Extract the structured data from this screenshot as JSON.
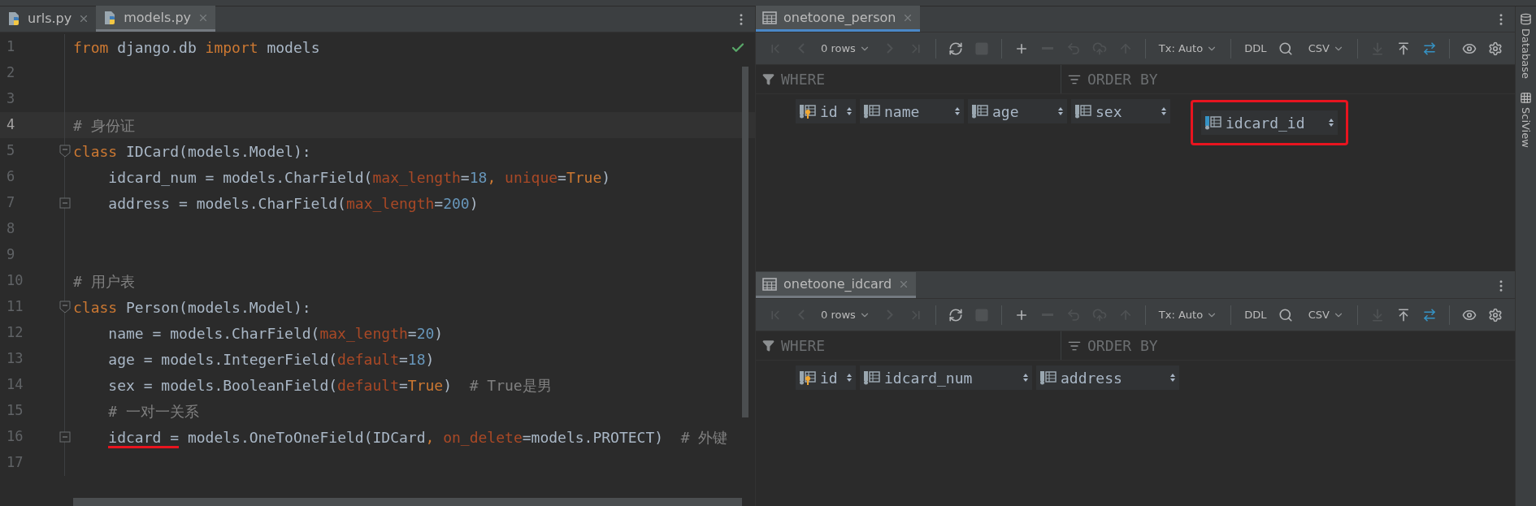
{
  "editor": {
    "focused": false,
    "inspections_ok": true,
    "tabs": [
      {
        "label": "urls.py",
        "selected": false
      },
      {
        "label": "models.py",
        "selected": true
      }
    ],
    "lines": [
      {
        "number": "1",
        "current": false,
        "kind": "plain",
        "tokens": [
          {
            "t": "from",
            "kind": "kw"
          },
          {
            "t": " django.db ",
            "kind": "text"
          },
          {
            "t": "import",
            "kind": "kw"
          },
          {
            "t": " models",
            "kind": "text"
          }
        ]
      },
      {
        "number": "2",
        "current": false,
        "kind": "plain"
      },
      {
        "number": "3",
        "current": false,
        "kind": "plain"
      },
      {
        "number": "4",
        "current": true,
        "kind": "plain",
        "tokens": [
          {
            "t": "# 身份证",
            "kind": "comment"
          }
        ]
      },
      {
        "number": "5",
        "current": false,
        "kind": "fold_start",
        "tokens": [
          {
            "t": "class",
            "kind": "kw"
          },
          {
            "t": " IDCard(models.Model):",
            "kind": "text"
          }
        ]
      },
      {
        "number": "6",
        "current": false,
        "kind": "plain",
        "tokens": [
          {
            "t": "    idcard_num = models.CharField(",
            "kind": "text"
          },
          {
            "t": "max_length",
            "kind": "param"
          },
          {
            "t": "=",
            "kind": "text"
          },
          {
            "t": "18",
            "kind": "num"
          },
          {
            "t": ", ",
            "kind": "kw"
          },
          {
            "t": "unique",
            "kind": "param"
          },
          {
            "t": "=",
            "kind": "text"
          },
          {
            "t": "True",
            "kind": "kw"
          },
          {
            "t": ")",
            "kind": "text"
          }
        ]
      },
      {
        "number": "7",
        "current": false,
        "kind": "fold_end",
        "tokens": [
          {
            "t": "    address = models.CharField(",
            "kind": "text"
          },
          {
            "t": "max_length",
            "kind": "param"
          },
          {
            "t": "=",
            "kind": "text"
          },
          {
            "t": "200",
            "kind": "num"
          },
          {
            "t": ")",
            "kind": "text"
          }
        ]
      },
      {
        "number": "8",
        "current": false,
        "kind": "plain"
      },
      {
        "number": "9",
        "current": false,
        "kind": "plain"
      },
      {
        "number": "10",
        "current": false,
        "kind": "plain",
        "tokens": [
          {
            "t": "# 用户表",
            "kind": "comment"
          }
        ]
      },
      {
        "number": "11",
        "current": false,
        "kind": "fold_start",
        "tokens": [
          {
            "t": "class",
            "kind": "kw"
          },
          {
            "t": " Person(models.Model):",
            "kind": "text"
          }
        ]
      },
      {
        "number": "12",
        "current": false,
        "kind": "plain",
        "tokens": [
          {
            "t": "    name = models.CharField(",
            "kind": "text"
          },
          {
            "t": "max_length",
            "kind": "param"
          },
          {
            "t": "=",
            "kind": "text"
          },
          {
            "t": "20",
            "kind": "num"
          },
          {
            "t": ")",
            "kind": "text"
          }
        ]
      },
      {
        "number": "13",
        "current": false,
        "kind": "plain",
        "tokens": [
          {
            "t": "    age = models.IntegerField(",
            "kind": "text"
          },
          {
            "t": "default",
            "kind": "param"
          },
          {
            "t": "=",
            "kind": "text"
          },
          {
            "t": "18",
            "kind": "num"
          },
          {
            "t": ")",
            "kind": "text"
          }
        ]
      },
      {
        "number": "14",
        "current": false,
        "kind": "plain",
        "tokens": [
          {
            "t": "    sex = models.BooleanField(",
            "kind": "text"
          },
          {
            "t": "default",
            "kind": "param"
          },
          {
            "t": "=",
            "kind": "text"
          },
          {
            "t": "True",
            "kind": "kw"
          },
          {
            "t": ")  ",
            "kind": "text"
          },
          {
            "t": "# True是男",
            "kind": "comment"
          }
        ]
      },
      {
        "number": "15",
        "current": false,
        "kind": "plain",
        "tokens": [
          {
            "t": "    # 一对一关系",
            "kind": "comment"
          }
        ]
      },
      {
        "number": "16",
        "current": false,
        "kind": "fold_end",
        "tokens": [
          {
            "t": "    idcard =",
            "kind": "text",
            "underlined": true
          },
          {
            "t": " models.OneToOneField(IDCard",
            "kind": "text"
          },
          {
            "t": ", ",
            "kind": "kw"
          },
          {
            "t": "on_delete",
            "kind": "param"
          },
          {
            "t": "=models.PROTECT)  ",
            "kind": "text"
          },
          {
            "t": "# 外键",
            "kind": "comment"
          }
        ]
      },
      {
        "number": "17",
        "current": false,
        "kind": "plain"
      }
    ]
  },
  "panels": [
    {
      "focused": true,
      "tab": {
        "label": "onetoone_person",
        "selected": true
      },
      "toolbar_left": [
        {
          "kind": "first",
          "disabled": true
        },
        {
          "kind": "prev",
          "disabled": true
        },
        {
          "kind": "dropdown",
          "label": "0 rows",
          "disabled": false
        },
        {
          "kind": "next",
          "disabled": true
        },
        {
          "kind": "last",
          "disabled": true
        },
        {
          "kind": "separator"
        },
        {
          "kind": "refresh",
          "disabled": false
        },
        {
          "kind": "stop",
          "disabled": true
        },
        {
          "kind": "separator"
        },
        {
          "kind": "add",
          "disabled": false
        },
        {
          "kind": "remove",
          "disabled": true
        },
        {
          "kind": "revert",
          "disabled": true
        },
        {
          "kind": "preview",
          "disabled": true
        },
        {
          "kind": "submit",
          "disabled": true
        },
        {
          "kind": "separator"
        },
        {
          "kind": "dropdown",
          "label": "Tx: Auto",
          "disabled": false
        },
        {
          "kind": "separator"
        },
        {
          "kind": "text",
          "label": "DDL",
          "disabled": false
        },
        {
          "kind": "search",
          "disabled": false
        }
      ],
      "toolbar_right": [
        {
          "kind": "dropdown",
          "label": "CSV",
          "disabled": false
        },
        {
          "kind": "separator"
        },
        {
          "kind": "export",
          "disabled": true
        },
        {
          "kind": "import",
          "disabled": false
        },
        {
          "kind": "compare",
          "disabled": false
        },
        {
          "kind": "separator"
        },
        {
          "kind": "view",
          "disabled": false
        },
        {
          "kind": "settings",
          "disabled": false
        }
      ],
      "where": {
        "placeholder": "WHERE"
      },
      "order_by": {
        "placeholder": "ORDER BY"
      },
      "columns": [
        {
          "name": "id",
          "kind": "key",
          "highlighted": false
        },
        {
          "name": "name",
          "kind": "column",
          "highlighted": false
        },
        {
          "name": "age",
          "kind": "column",
          "highlighted": false
        },
        {
          "name": "sex",
          "kind": "column",
          "highlighted": false
        },
        {
          "name": "idcard_id",
          "kind": "foreign_key",
          "highlighted": true
        }
      ]
    },
    {
      "focused": false,
      "tab": {
        "label": "onetoone_idcard",
        "selected": true
      },
      "toolbar_left": [
        {
          "kind": "first",
          "disabled": true
        },
        {
          "kind": "prev",
          "disabled": true
        },
        {
          "kind": "dropdown",
          "label": "0 rows",
          "disabled": false
        },
        {
          "kind": "next",
          "disabled": true
        },
        {
          "kind": "last",
          "disabled": true
        },
        {
          "kind": "separator"
        },
        {
          "kind": "refresh",
          "disabled": false
        },
        {
          "kind": "stop",
          "disabled": true
        },
        {
          "kind": "separator"
        },
        {
          "kind": "add",
          "disabled": false
        },
        {
          "kind": "remove",
          "disabled": true
        },
        {
          "kind": "revert",
          "disabled": true
        },
        {
          "kind": "preview",
          "disabled": true
        },
        {
          "kind": "submit",
          "disabled": true
        },
        {
          "kind": "separator"
        },
        {
          "kind": "dropdown",
          "label": "Tx: Auto",
          "disabled": false
        },
        {
          "kind": "separator"
        },
        {
          "kind": "text",
          "label": "DDL",
          "disabled": false
        },
        {
          "kind": "search",
          "disabled": false
        }
      ],
      "toolbar_right": [
        {
          "kind": "dropdown",
          "label": "CSV",
          "disabled": false
        },
        {
          "kind": "separator"
        },
        {
          "kind": "export",
          "disabled": true
        },
        {
          "kind": "import",
          "disabled": false
        },
        {
          "kind": "compare",
          "disabled": false
        },
        {
          "kind": "separator"
        },
        {
          "kind": "view",
          "disabled": false
        },
        {
          "kind": "settings",
          "disabled": false
        }
      ],
      "where": {
        "placeholder": "WHERE"
      },
      "order_by": {
        "placeholder": "ORDER BY"
      },
      "columns": [
        {
          "name": "id",
          "kind": "key",
          "highlighted": false
        },
        {
          "name": "idcard_num",
          "kind": "column",
          "highlighted": false
        },
        {
          "name": "address",
          "kind": "column",
          "highlighted": false
        }
      ]
    }
  ],
  "sidebar": [
    {
      "label": "Database",
      "kind": "database"
    },
    {
      "label": "SciView",
      "kind": "grid"
    }
  ]
}
